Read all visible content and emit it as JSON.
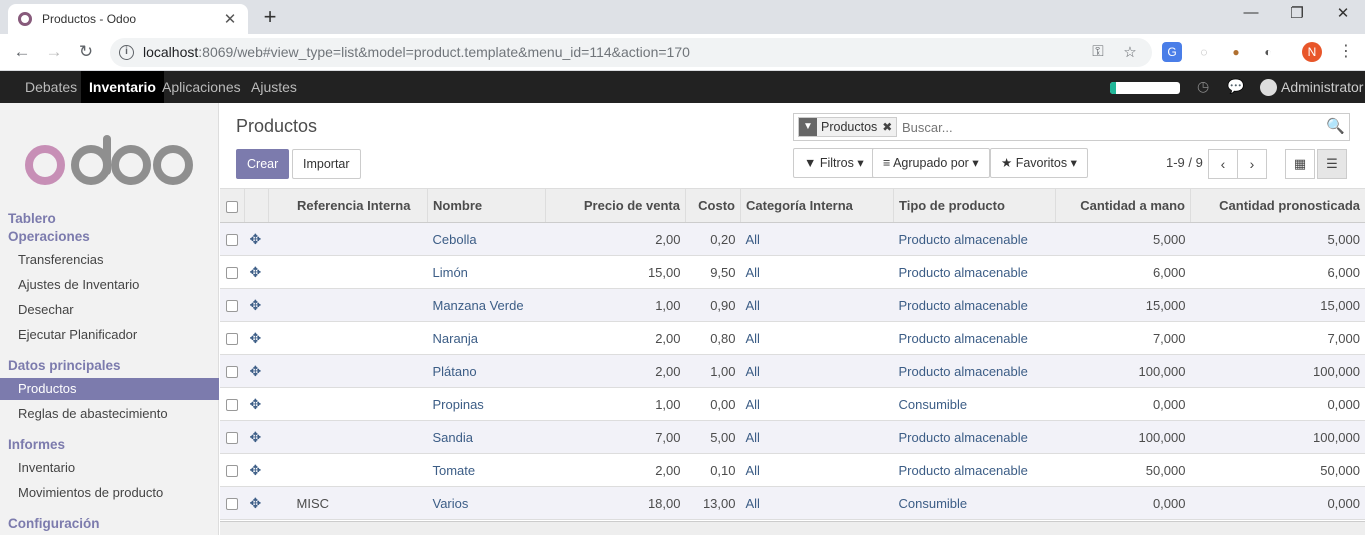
{
  "browser": {
    "tab_title": "Productos - Odoo",
    "url_host": "localhost",
    "url_rest": ":8069/web#view_type=list&model=product.template&menu_id=114&action=170",
    "profile_initial": "N"
  },
  "mainnav": {
    "items": [
      "Debates",
      "Inventario",
      "Aplicaciones",
      "Ajustes"
    ],
    "active": "Inventario",
    "progress_fraction": 0.08,
    "user": "Administrator"
  },
  "sidebar": {
    "sections": [
      {
        "label": "Tablero",
        "items": []
      },
      {
        "label": "Operaciones",
        "items": [
          "Transferencias",
          "Ajustes de Inventario",
          "Desechar",
          "Ejecutar Planificador"
        ]
      },
      {
        "label": "Datos principales",
        "items": [
          "Productos",
          "Reglas de abastecimiento"
        ]
      },
      {
        "label": "Informes",
        "items": [
          "Inventario",
          "Movimientos de producto"
        ]
      },
      {
        "label": "Configuración",
        "items": []
      }
    ],
    "active_item": "Productos"
  },
  "page": {
    "title": "Productos",
    "create_label": "Crear",
    "import_label": "Importar",
    "facet_label": "Productos",
    "search_placeholder": "Buscar...",
    "filters_label": "Filtros",
    "groupby_label": "Agrupado por",
    "favorites_label": "Favoritos",
    "pager": "1-9 / 9"
  },
  "table": {
    "columns": [
      "Referencia Interna",
      "Nombre",
      "Precio de venta",
      "Costo",
      "Categoría Interna",
      "Tipo de producto",
      "Cantidad a mano",
      "Cantidad pronosticada"
    ],
    "rows": [
      {
        "ref": "",
        "name": "Cebolla",
        "price": "2,00",
        "cost": "0,20",
        "category": "All",
        "type": "Producto almacenable",
        "onhand": "5,000",
        "forecast": "5,000"
      },
      {
        "ref": "",
        "name": "Limón",
        "price": "15,00",
        "cost": "9,50",
        "category": "All",
        "type": "Producto almacenable",
        "onhand": "6,000",
        "forecast": "6,000"
      },
      {
        "ref": "",
        "name": "Manzana Verde",
        "price": "1,00",
        "cost": "0,90",
        "category": "All",
        "type": "Producto almacenable",
        "onhand": "15,000",
        "forecast": "15,000"
      },
      {
        "ref": "",
        "name": "Naranja",
        "price": "2,00",
        "cost": "0,80",
        "category": "All",
        "type": "Producto almacenable",
        "onhand": "7,000",
        "forecast": "7,000"
      },
      {
        "ref": "",
        "name": "Plátano",
        "price": "2,00",
        "cost": "1,00",
        "category": "All",
        "type": "Producto almacenable",
        "onhand": "100,000",
        "forecast": "100,000"
      },
      {
        "ref": "",
        "name": "Propinas",
        "price": "1,00",
        "cost": "0,00",
        "category": "All",
        "type": "Consumible",
        "onhand": "0,000",
        "forecast": "0,000"
      },
      {
        "ref": "",
        "name": "Sandia",
        "price": "7,00",
        "cost": "5,00",
        "category": "All",
        "type": "Producto almacenable",
        "onhand": "100,000",
        "forecast": "100,000"
      },
      {
        "ref": "",
        "name": "Tomate",
        "price": "2,00",
        "cost": "0,10",
        "category": "All",
        "type": "Producto almacenable",
        "onhand": "50,000",
        "forecast": "50,000"
      },
      {
        "ref": "MISC",
        "name": "Varios",
        "price": "18,00",
        "cost": "13,00",
        "category": "All",
        "type": "Consumible",
        "onhand": "0,000",
        "forecast": "0,000"
      }
    ]
  }
}
